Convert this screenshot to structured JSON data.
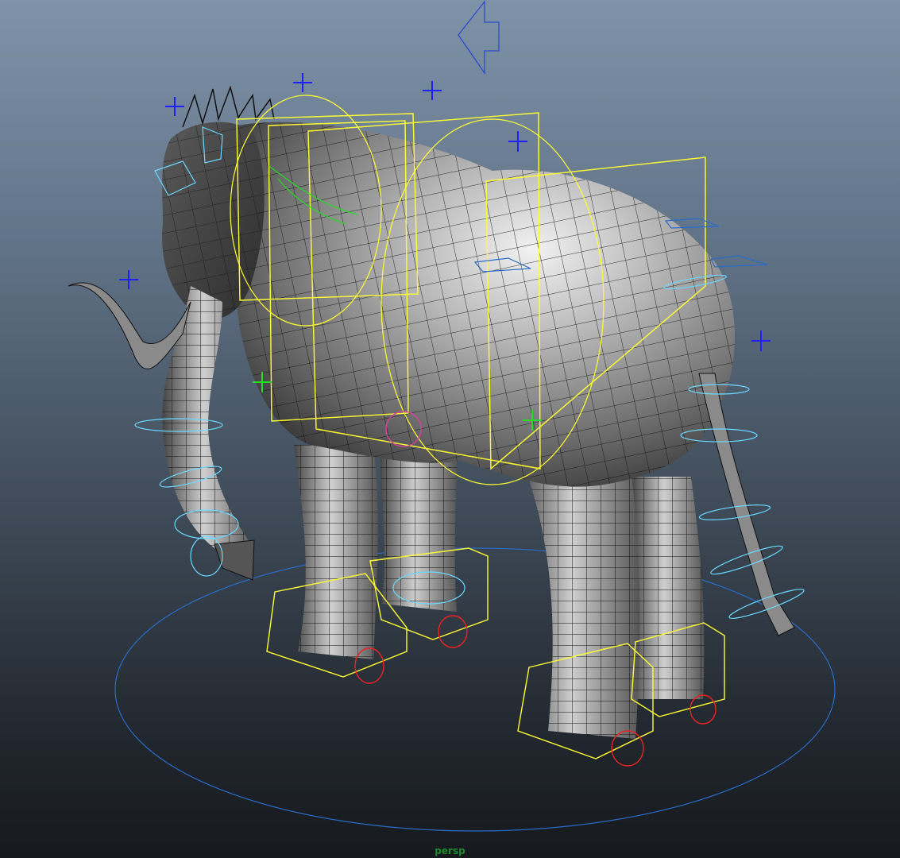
{
  "viewport": {
    "camera_label": "persp",
    "camera_label_color": "#1a8a2a"
  },
  "colors": {
    "mesh_fill": "#8c8c8c",
    "mesh_wire": "#111111",
    "ik_box": "#ffff33",
    "ground_circle": "#2a6cc8",
    "locator_blue": "#2020ff",
    "locator_green": "#22dd22",
    "ring_cyan": "#6ad8ff",
    "foot_pivot_red": "#ee2222",
    "hip_magenta": "#e040a0"
  },
  "scene_objects": [
    "elephant-mesh",
    "ground-control-circle",
    "direction-arrow",
    "ik-box-controls",
    "locators",
    "spine-rings"
  ]
}
